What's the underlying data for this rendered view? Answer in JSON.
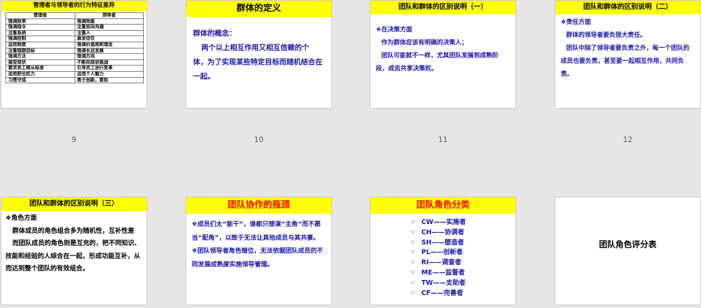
{
  "slides": [
    {
      "number": "9",
      "title": "管理者与领导者的行为特征差异",
      "table": {
        "headers": [
          "管理者",
          "领导者"
        ],
        "rows": [
          [
            "强调效率",
            "强调效能"
          ],
          [
            "强调指令",
            "注重双向沟通"
          ],
          [
            "注重系统",
            "注重人"
          ],
          [
            "强调控制",
            "激发信任"
          ],
          [
            "运用制度",
            "强调价值观和理念"
          ],
          [
            "注重短期目标",
            "强调长远发展"
          ],
          [
            "强调方法",
            "强调方向"
          ],
          [
            "接受现状",
            "不断向现状挑战"
          ],
          [
            "要求员工顺从标准",
            "引导员工进行变革"
          ],
          [
            "运用职位权力",
            "运用个人魅力"
          ],
          [
            "习惯守成",
            "勇于创新、冒险"
          ]
        ]
      }
    },
    {
      "number": "10",
      "title": "群体的定义",
      "lines": [
        "群体的概念：",
        "两个以上相互作用又相互信赖的个体，为了实现某些特定目标而随机结合在一起。"
      ]
    },
    {
      "number": "11",
      "title": "团队和群体的区别说明（一）",
      "heading": "在决策方面",
      "paras": [
        "作为群体应该有明确的决策人；",
        "团队可能就不一样，尤其团队发展到成熟阶段，成员共享决策权。"
      ]
    },
    {
      "number": "12",
      "title": "团队和群体的区别说明（二）",
      "heading": "责任方面",
      "paras": [
        "群体的领导者要负很大责任。",
        "团队中除了领导者要负责之外，每一个团队的成员也要负责，甚至要一起相互作用，共同负责。"
      ]
    },
    {
      "title": "团队和群体的区别说明（三）",
      "heading": "角色方面",
      "paras": [
        "群体成员的角色组合多为随机性，互补性差",
        "而团队成员的角色则是互充的，把不同知识、技能和经验的人综合在一起，形成功能互补，从而达到整个团队的有效组合。"
      ]
    },
    {
      "title": "团队协作的瓶颈",
      "bullets": [
        "成员们太“能干”，谁都只想演“主角”而不愿当“配角”，以致于无法让其他成员与其共事。",
        "团队领导者角色错位，无法依据团队成员的不同发展成熟度实施领导管理。"
      ]
    },
    {
      "title": "团队角色分类",
      "roles": [
        "CW——实施者",
        "CH——协调者",
        "SH——塑造者",
        "PL——创新者",
        "RI——调查者",
        "ME——监督者",
        "TW——支助者",
        "CF——完善者"
      ]
    },
    {
      "title": "团队角色评分表"
    }
  ],
  "icons": {
    "bullet": "diamond-icon",
    "role_pointer": "pointing-hand-icon"
  },
  "colors": {
    "title_bar": "#ffff00",
    "body_text": "#1a1aa6",
    "red_title": "#ff0000",
    "background": "#e6e6e6"
  }
}
